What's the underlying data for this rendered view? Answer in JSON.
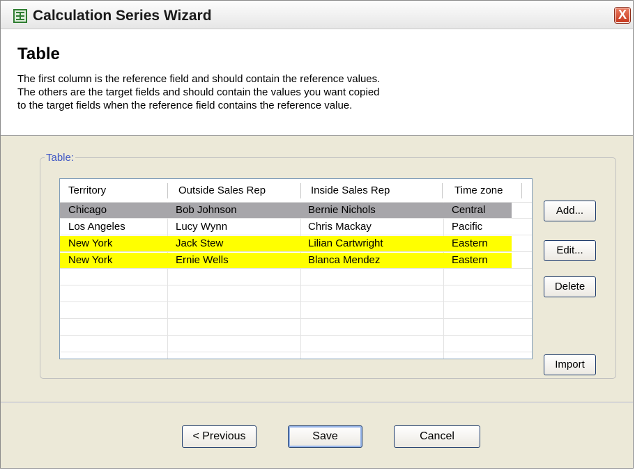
{
  "window": {
    "title": "Calculation Series Wizard",
    "close_label": "X"
  },
  "header": {
    "title": "Table",
    "description": [
      "The first column is the reference field and should contain the reference values.",
      "The others are the target fields and should contain  the values you want copied",
      "to the target fields when the reference field contains the reference value."
    ]
  },
  "group": {
    "label": "Table:"
  },
  "table": {
    "columns": [
      "Territory",
      "Outside Sales Rep",
      "Inside Sales Rep",
      "Time zone"
    ],
    "rows": [
      {
        "cells": [
          "Chicago",
          "Bob Johnson",
          "Bernie Nichols",
          "Central"
        ],
        "state": "selected"
      },
      {
        "cells": [
          "Los Angeles",
          "Lucy Wynn",
          "Chris Mackay",
          "Pacific"
        ],
        "state": "normal"
      },
      {
        "cells": [
          "New York",
          "Jack Stew",
          "Lilian Cartwright",
          "Eastern"
        ],
        "state": "highlighted"
      },
      {
        "cells": [
          "New York",
          "Ernie Wells",
          "Blanca Mendez",
          "Eastern"
        ],
        "state": "highlighted"
      }
    ],
    "selected_color": "#a7a6aa",
    "highlight_color": "#ffff00"
  },
  "side_buttons": {
    "add": "Add...",
    "edit": "Edit...",
    "delete": "Delete",
    "import": "Import"
  },
  "footer": {
    "previous": "< Previous",
    "save": "Save",
    "cancel": "Cancel"
  },
  "colors": {
    "accent": "#3f57c5",
    "close_button": "#c7381e"
  }
}
